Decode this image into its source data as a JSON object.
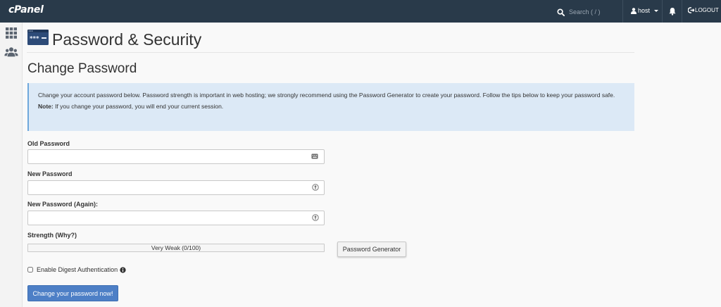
{
  "app": {
    "logo": "cPanel"
  },
  "topbar": {
    "search_placeholder": "Search ( / )",
    "user_name": "host",
    "logout_label": "LOGOUT"
  },
  "header": {
    "title": "Password & Security"
  },
  "section": {
    "title": "Change Password"
  },
  "info": {
    "text": "Change your account password below. Password strength is important in web hosting; we strongly recommend using the Password Generator to create your password. Follow the tips below to keep your password safe.",
    "note_label": "Note:",
    "note_text": " If you change your password, you will end your current session."
  },
  "form": {
    "old_password_label": "Old Password",
    "old_password_value": "",
    "new_password_label": "New Password",
    "new_password_value": "",
    "new_password_again_label": "New Password (Again):",
    "new_password_again_value": "",
    "strength_label": "Strength (Why?)",
    "strength_text": "Very Weak (0/100)",
    "strength_value": 0,
    "generator_label": "Password Generator",
    "digest_label": "Enable Digest Authentication",
    "digest_checked": false,
    "submit_label": "Change your password now!"
  },
  "colors": {
    "topbar": "#293a4a",
    "info_bg": "#dce9f6",
    "primary": "#4d7fc6"
  },
  "icons": [
    "search-icon",
    "user-icon",
    "caret-down-icon",
    "bell-icon",
    "logout-icon",
    "grid-icon",
    "users-icon",
    "password-security-icon",
    "keyboard-icon",
    "info-icon"
  ]
}
